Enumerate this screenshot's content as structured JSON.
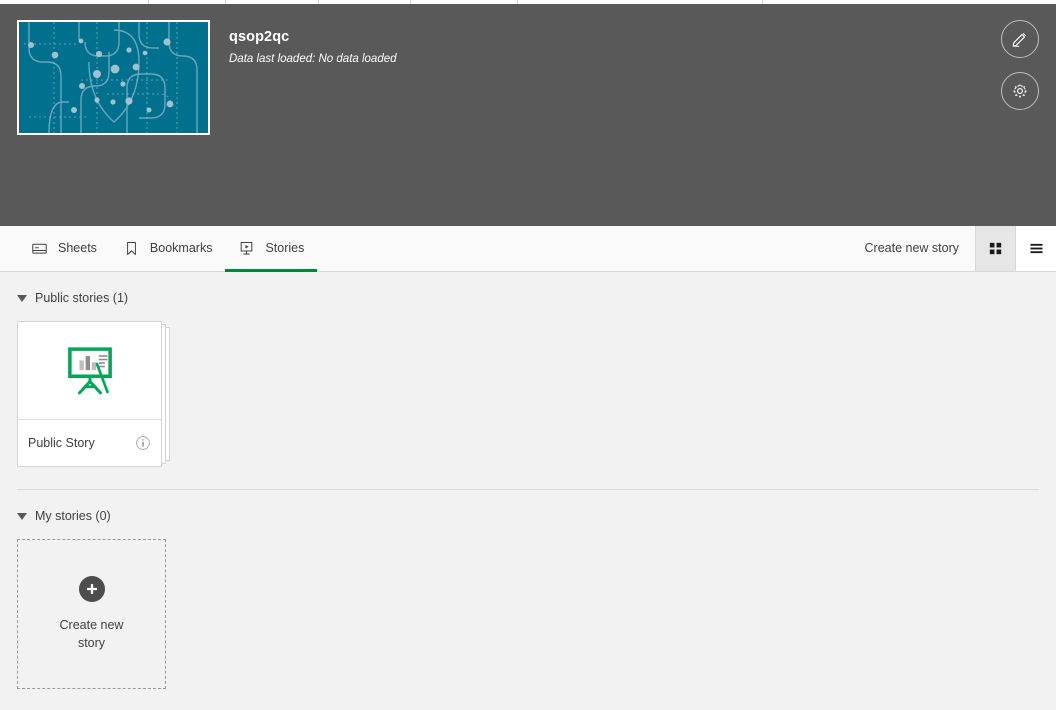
{
  "topbar": {
    "divider_positions": [
      148,
      225,
      318,
      410,
      517,
      762
    ]
  },
  "app": {
    "title": "qsop2qc",
    "subtitle": "Data last loaded: No data loaded",
    "thumbnail_bg": "#00708f",
    "header_bg": "#595959"
  },
  "header_actions": [
    {
      "name": "edit-app-button",
      "icon": "pencil-icon"
    },
    {
      "name": "app-settings-button",
      "icon": "gear-icon"
    }
  ],
  "toolbar": {
    "tabs": [
      {
        "label": "Sheets",
        "icon": "sheets-icon",
        "active": false
      },
      {
        "label": "Bookmarks",
        "icon": "bookmark-icon",
        "active": false
      },
      {
        "label": "Stories",
        "icon": "story-icon",
        "active": true
      }
    ],
    "active_tab_color": "#00873d",
    "create_label": "Create new story",
    "view_modes": [
      {
        "name": "grid-view",
        "icon": "grid-icon",
        "active": true
      },
      {
        "name": "list-view",
        "icon": "list-icon",
        "active": false
      }
    ]
  },
  "sections": {
    "public": {
      "title": "Public stories (1)",
      "expanded": true,
      "cards": [
        {
          "name": "Public Story",
          "icon": "easel-chart-icon",
          "info": "info-icon"
        }
      ]
    },
    "mine": {
      "title": "My stories (0)",
      "expanded": true,
      "create_card": {
        "label": "Create new story",
        "icon": "plus-circle-icon"
      }
    }
  }
}
